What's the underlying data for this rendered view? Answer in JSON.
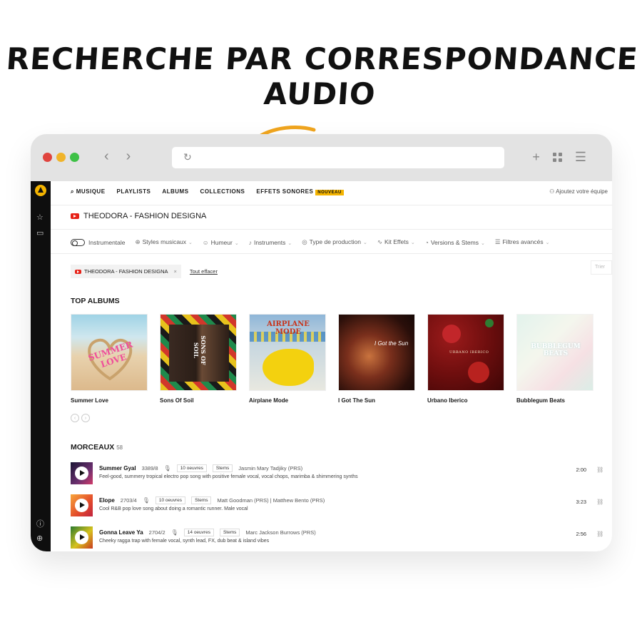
{
  "headline": "RECHERCHE PAR CORRESPONDANCE AUDIO",
  "browser": {
    "reload_icon": "reload-icon",
    "back_icon": "chevron-left-icon",
    "forward_icon": "chevron-right-icon"
  },
  "nav": {
    "items": [
      "MUSIQUE",
      "PLAYLISTS",
      "ALBUMS",
      "COLLECTIONS",
      "EFFETS SONORES"
    ],
    "new_badge": "NOUVEAU",
    "add_account": "Ajoutez votre équipe"
  },
  "search": {
    "query": "THEODORA - FASHION DESIGNA"
  },
  "filters": [
    {
      "label": "Instrumentale",
      "icon": "toggle-icon"
    },
    {
      "label": "Styles musicaux",
      "icon": "globe-icon"
    },
    {
      "label": "Humeur",
      "icon": "smiley-icon"
    },
    {
      "label": "Instruments",
      "icon": "guitar-icon"
    },
    {
      "label": "Type de production",
      "icon": "production-icon"
    },
    {
      "label": "Kit Effets",
      "icon": "waveform-icon"
    },
    {
      "label": "Versions & Stems",
      "icon": "versions-icon"
    },
    {
      "label": "Filtres avancés",
      "icon": "sliders-icon"
    }
  ],
  "active_filter": {
    "label": "THEODORA - FASHION DESIGNA",
    "clear": "Tout effacer",
    "sort_placeholder": "Trier"
  },
  "albums_section": {
    "title": "TOP ALBUMS",
    "albums": [
      {
        "title": "Summer Love",
        "cover_text": "SUMMER LOVE"
      },
      {
        "title": "Sons Of Soil",
        "cover_text": "SONS OF SOIL"
      },
      {
        "title": "Airplane Mode",
        "cover_text": "AIRPLANE MODE"
      },
      {
        "title": "I Got The Sun",
        "cover_text": "I Got the Sun"
      },
      {
        "title": "Urbano Iberico",
        "cover_text": "URBANO IBERICO"
      },
      {
        "title": "Bubblegum Beats",
        "cover_text": "BUBBLEGUM BEATS"
      }
    ]
  },
  "tracks_section": {
    "title": "MORCEAUX",
    "count": "58",
    "tracks": [
      {
        "name": "Summer Gyal",
        "code": "3389/8",
        "works": "10 oeuvres",
        "stems": "Stems",
        "composer": "Jasmin Mary Tadjiky (PRS)",
        "description": "Feel-good, summery tropical electro pop song with positive female vocal, vocal chops, marimba & shimmering synths",
        "duration": "2:00"
      },
      {
        "name": "Elope",
        "code": "2703/4",
        "works": "10 oeuvres",
        "stems": "Stems",
        "composer": "Matt Goodman (PRS) | Matthew Bento (PRS)",
        "description": "Cool R&B pop love song about doing a romantic runner. Male vocal",
        "duration": "3:23"
      },
      {
        "name": "Gonna Leave Ya",
        "code": "2704/2",
        "works": "14 oeuvres",
        "stems": "Stems",
        "composer": "Marc Jackson Burrows (PRS)",
        "description": "Cheeky ragga trap with female vocal, synth lead, FX, dub beat & island vibes",
        "duration": "2:56"
      }
    ]
  },
  "colors": {
    "accent": "#f4b400",
    "arrow": "#f0a51e",
    "sidebar": "#0e0e0e",
    "youtube": "#e62117"
  }
}
